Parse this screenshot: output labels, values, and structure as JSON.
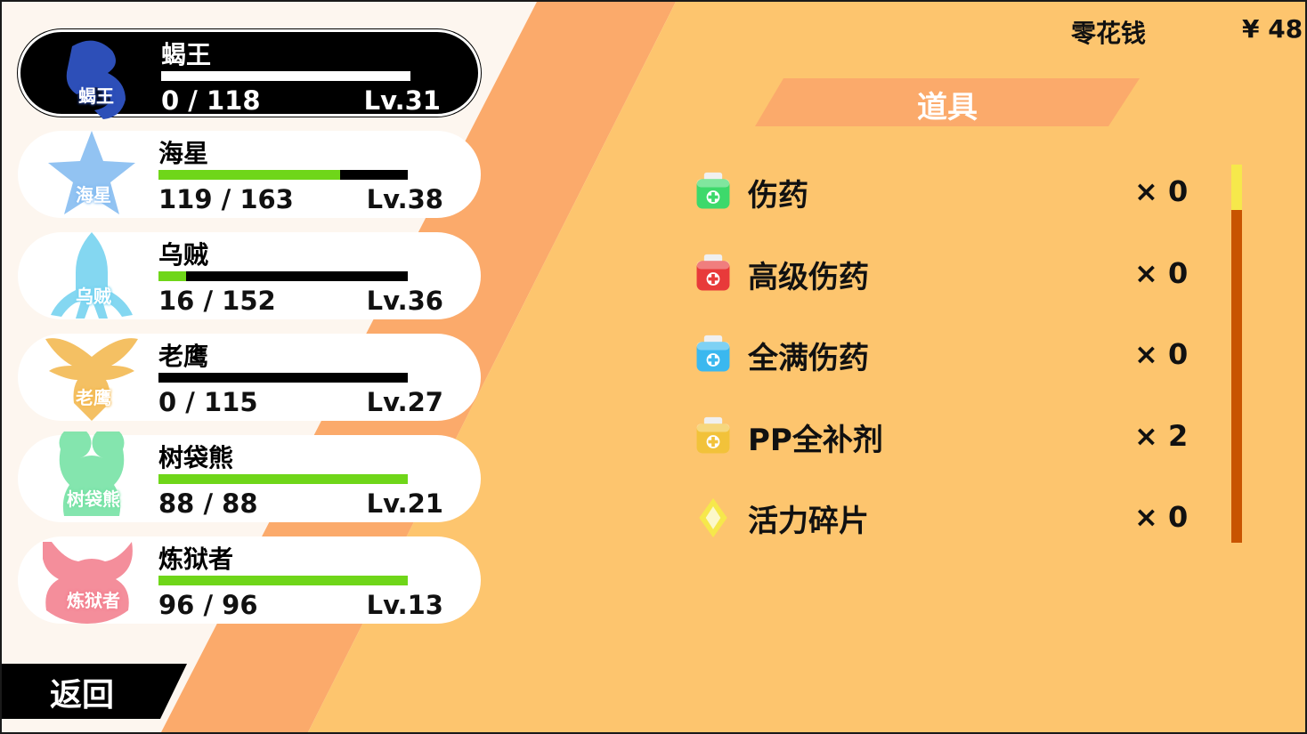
{
  "colors": {
    "background_left": "#fdf6ef",
    "stripe": "#fbaa6b",
    "panel": "#fdc56e",
    "hp_fill": "#6fd619",
    "scroll_track": "#c85400",
    "scroll_thumb": "#f6e84b"
  },
  "party": [
    {
      "name": "蝎王",
      "emblem": "蝎王",
      "icon": "scorpion-icon",
      "emblem_color": "#2d4fb8",
      "hp": "0 / 118",
      "hp_fraction": 0.0,
      "level": "Lv.31",
      "selected": true
    },
    {
      "name": "海星",
      "emblem": "海星",
      "icon": "starfish-icon",
      "emblem_color": "#7fb8f0",
      "hp": "119 / 163",
      "hp_fraction": 0.73,
      "level": "Lv.38",
      "selected": false
    },
    {
      "name": "乌贼",
      "emblem": "乌贼",
      "icon": "squid-icon",
      "emblem_color": "#6ed0ef",
      "hp": "16 / 152",
      "hp_fraction": 0.105,
      "level": "Lv.36",
      "selected": false
    },
    {
      "name": "老鹰",
      "emblem": "老鹰",
      "icon": "eagle-icon",
      "emblem_color": "#f2b548",
      "hp": "0 / 115",
      "hp_fraction": 0.0,
      "level": "Lv.27",
      "selected": false
    },
    {
      "name": "树袋熊",
      "emblem": "树袋熊",
      "icon": "koala-icon",
      "emblem_color": "#6fe0a0",
      "hp": "88 / 88",
      "hp_fraction": 1.0,
      "level": "Lv.21",
      "selected": false
    },
    {
      "name": "炼狱者",
      "emblem": "炼狱者",
      "icon": "demon-icon",
      "emblem_color": "#f27a8a",
      "hp": "96 / 96",
      "hp_fraction": 1.0,
      "level": "Lv.13",
      "selected": false
    }
  ],
  "back_button": {
    "label": "返回"
  },
  "money": {
    "label": "零花钱",
    "value": "¥ 48"
  },
  "items_title": "道具",
  "items": [
    {
      "name": "伤药",
      "qty": "× 0",
      "icon": "green-potion-icon",
      "color": "#3dd96b"
    },
    {
      "name": "高级伤药",
      "qty": "× 0",
      "icon": "red-potion-icon",
      "color": "#e83a3a"
    },
    {
      "name": "全满伤药",
      "qty": "× 0",
      "icon": "blue-potion-icon",
      "color": "#3ab8ef"
    },
    {
      "name": "PP全补剂",
      "qty": "× 2",
      "icon": "yellow-potion-icon",
      "color": "#f2c23a"
    },
    {
      "name": "活力碎片",
      "qty": "× 0",
      "icon": "diamond-shard-icon",
      "color": "#f6e84b"
    }
  ],
  "scrollbar": {
    "thumb_fraction": 0.12
  }
}
